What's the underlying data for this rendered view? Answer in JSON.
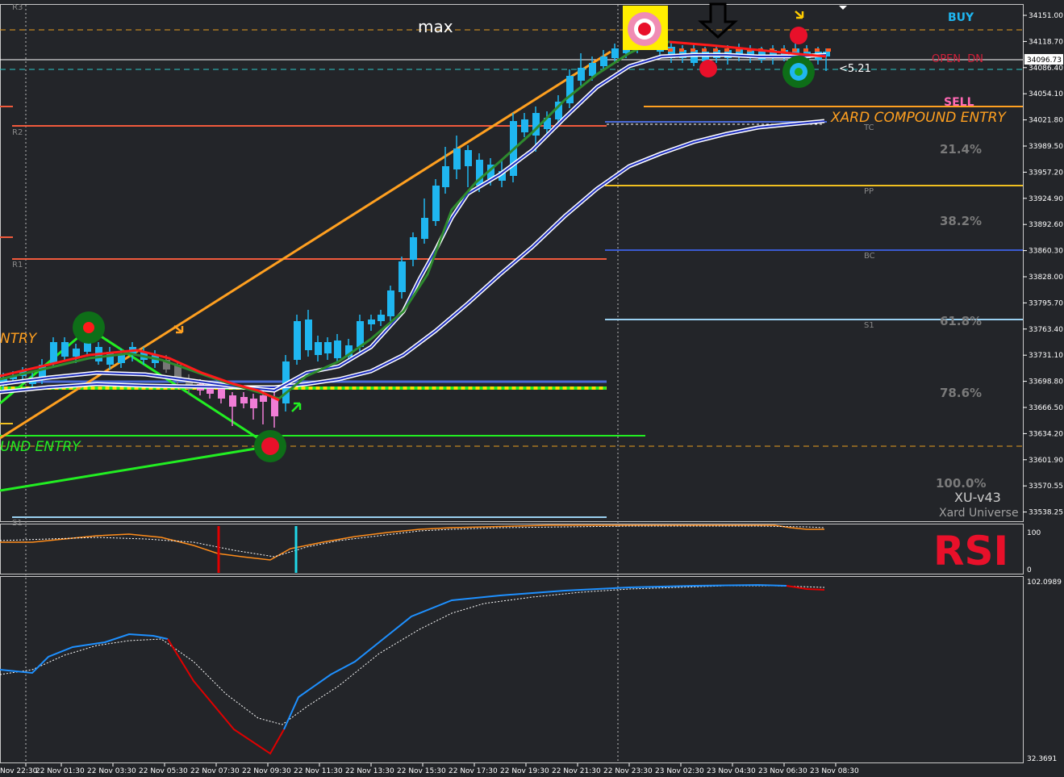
{
  "main_panel": {
    "title_text": "max",
    "y_axis_ticks": [
      "34151.00",
      "34118.70",
      "34086.40",
      "34054.10",
      "34021.80",
      "33989.50",
      "33957.20",
      "33924.90",
      "33892.60",
      "33860.30",
      "33828.00",
      "33795.70",
      "33763.40",
      "33731.10",
      "33698.80",
      "33666.50",
      "33634.20",
      "33601.90",
      "33570.55",
      "33538.25"
    ],
    "current_price_tag": "34096.73",
    "current_price": 34096.73,
    "signals": {
      "buy": "BUY",
      "open_dn": "OPEN  DN",
      "sell": "SELL"
    },
    "compound_entry_right": "XARD COMPOUND ENTRY",
    "compound_entry_left_top": "NTRY",
    "compound_entry_left_bottom": "UND ENTRY",
    "pivot_labels": {
      "r3": "R3",
      "r2": "R2",
      "r1": "R1",
      "s1_left": "S1",
      "tc": "TC",
      "pp": "PP",
      "bc": "BC",
      "s1_right": "S1"
    },
    "fib_labels": [
      "21.4%",
      "38.2%",
      "61.8%",
      "78.6%",
      "100.0%"
    ],
    "distance_label": "<5.21",
    "brand_version": "XU-v43",
    "brand_name": "Xard Universe",
    "colors": {
      "bull": "#1fb6f0",
      "bear_pink": "#f07dd6",
      "ma_green": "#2e8b2e",
      "ma_red": "#ff1a1a",
      "orange": "#ffa020",
      "buy": "#1fb6f0",
      "sell": "#ff69b4",
      "open_dn": "#d0203a"
    }
  },
  "rsi_panel": {
    "label": "RSI",
    "y_ticks": [
      "100",
      "0"
    ],
    "colors": {
      "line": "#ff8c1a",
      "label": "#e8102a"
    }
  },
  "lower_panel": {
    "y_ticks": [
      "102.0989",
      "32.3691"
    ],
    "colors": {
      "line_up": "#1e90ff",
      "line_down": "#e00000"
    }
  },
  "x_axis": {
    "labels": [
      "Nov 22:30",
      "22 Nov 01:30",
      "22 Nov 03:30",
      "22 Nov 05:30",
      "22 Nov 07:30",
      "22 Nov 09:30",
      "22 Nov 11:30",
      "22 Nov 13:30",
      "22 Nov 15:30",
      "22 Nov 17:30",
      "22 Nov 19:30",
      "22 Nov 21:30",
      "22 Nov 23:30",
      "23 Nov 02:30",
      "23 Nov 04:30",
      "23 Nov 06:30",
      "23 Nov 08:30"
    ]
  }
}
